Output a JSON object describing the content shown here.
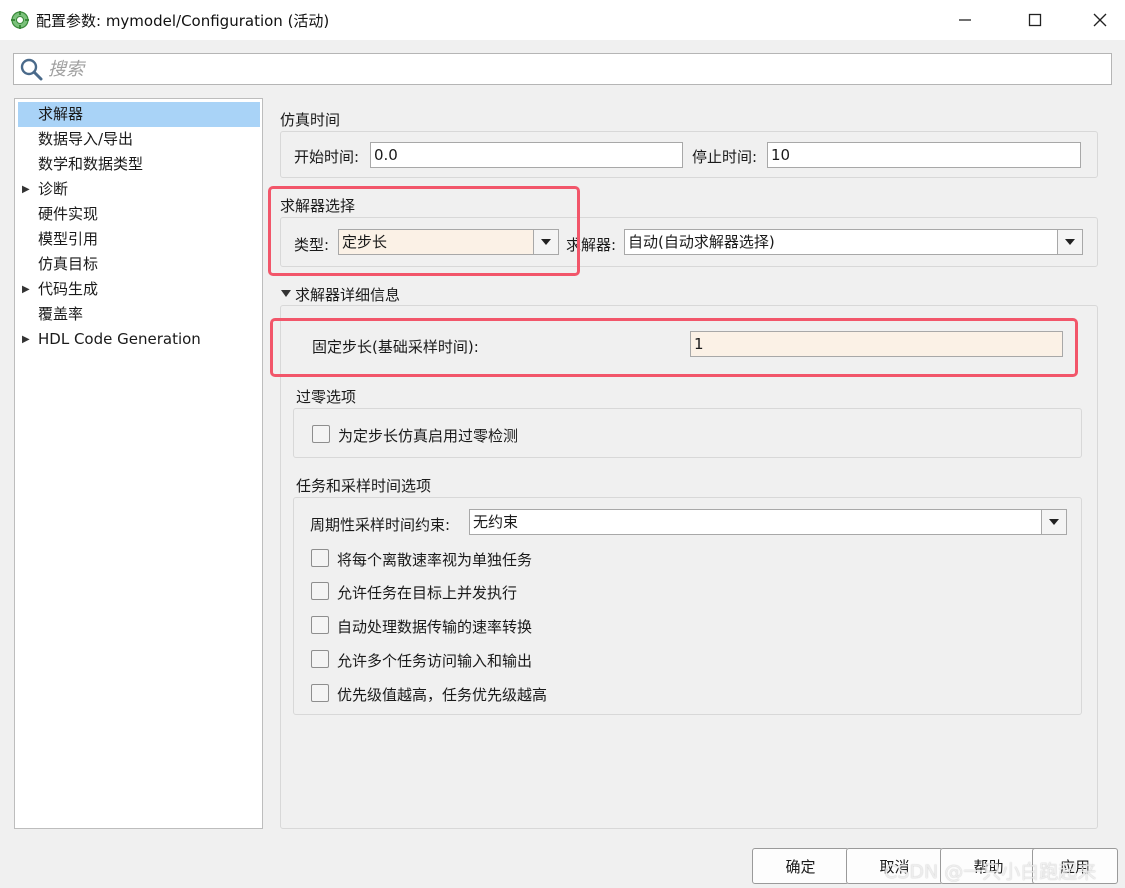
{
  "window": {
    "title": "配置参数: mymodel/Configuration (活动)",
    "minimize_glyph": "—",
    "maximize_glyph": "☐",
    "close_glyph": "✕"
  },
  "search": {
    "placeholder": "搜索"
  },
  "tree": {
    "items": [
      {
        "label": "求解器",
        "selected": true,
        "expandable": false
      },
      {
        "label": "数据导入/导出",
        "selected": false,
        "expandable": false
      },
      {
        "label": "数学和数据类型",
        "selected": false,
        "expandable": false
      },
      {
        "label": "诊断",
        "selected": false,
        "expandable": true
      },
      {
        "label": "硬件实现",
        "selected": false,
        "expandable": false
      },
      {
        "label": "模型引用",
        "selected": false,
        "expandable": false
      },
      {
        "label": "仿真目标",
        "selected": false,
        "expandable": false
      },
      {
        "label": "代码生成",
        "selected": false,
        "expandable": true
      },
      {
        "label": "覆盖率",
        "selected": false,
        "expandable": false
      },
      {
        "label": "HDL Code Generation",
        "selected": false,
        "expandable": true
      }
    ]
  },
  "sim_time": {
    "title": "仿真时间",
    "start_label": "开始时间:",
    "start_value": "0.0",
    "stop_label": "停止时间:",
    "stop_value": "10"
  },
  "solver_select": {
    "title": "求解器选择",
    "type_label": "类型:",
    "type_value": "定步长",
    "solver_label": "求解器:",
    "solver_value": "自动(自动求解器选择)"
  },
  "solver_details": {
    "title": "求解器详细信息",
    "step_label": "固定步长(基础采样时间):",
    "step_value": "1",
    "zero_crossing": {
      "title": "过零选项",
      "checkbox_label": "为定步长仿真启用过零检测",
      "checked": false
    },
    "tasking": {
      "title": "任务和采样时间选项",
      "constraint_label": "周期性采样时间约束:",
      "constraint_value": "无约束",
      "options": [
        {
          "label": "将每个离散速率视为单独任务",
          "checked": false
        },
        {
          "label": "允许任务在目标上并发执行",
          "checked": false
        },
        {
          "label": "自动处理数据传输的速率转换",
          "checked": false
        },
        {
          "label": "允许多个任务访问输入和输出",
          "checked": false
        },
        {
          "label": "优先级值越高，任务优先级越高",
          "checked": false
        }
      ]
    }
  },
  "buttons": {
    "ok": "确定",
    "cancel": "取消",
    "help": "帮助",
    "apply": "应用"
  },
  "watermark": "CSDN @一只小白跑起来",
  "colors": {
    "selection": "#a9d3f7",
    "highlight_field": "#fbf1e6",
    "annotation_frame": "#f2566a"
  }
}
